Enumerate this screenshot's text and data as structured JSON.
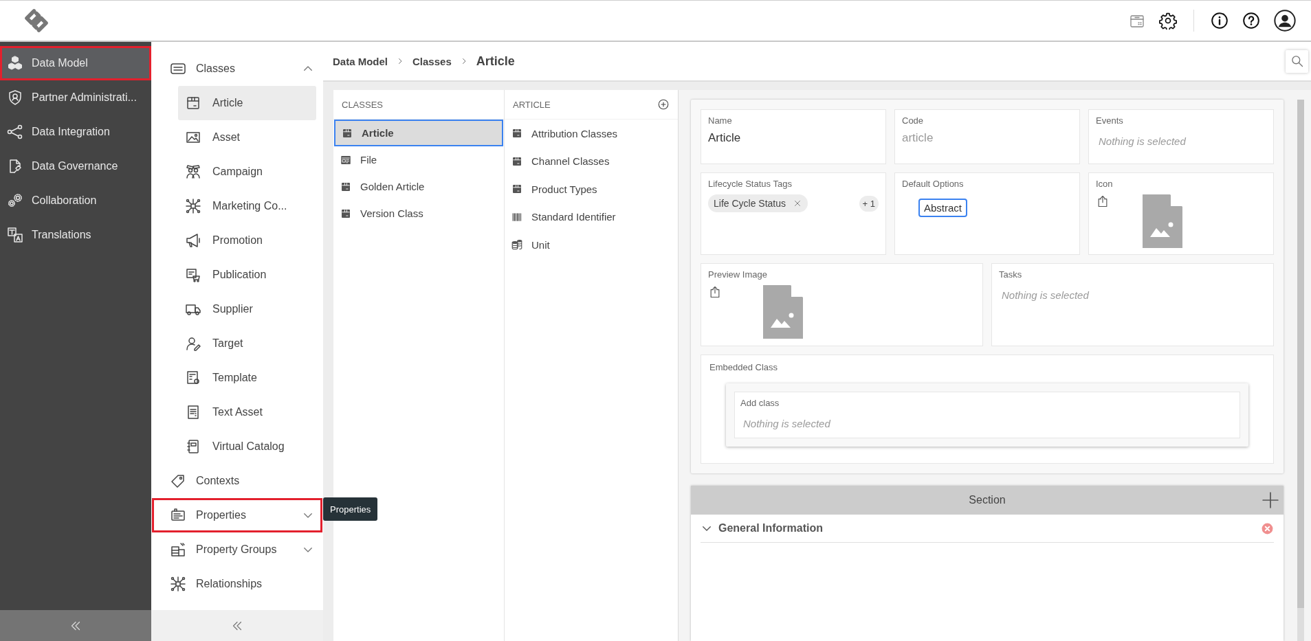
{
  "main_nav": {
    "items": [
      {
        "label": "Data Model",
        "selected": true,
        "highlighted": true
      },
      {
        "label": "Partner Administrati...",
        "selected": false,
        "highlighted": false
      },
      {
        "label": "Data Integration",
        "selected": false,
        "highlighted": false
      },
      {
        "label": "Data Governance",
        "selected": false,
        "highlighted": false
      },
      {
        "label": "Collaboration",
        "selected": false,
        "highlighted": false
      },
      {
        "label": "Translations",
        "selected": false,
        "highlighted": false
      }
    ]
  },
  "sub_nav": {
    "items": [
      {
        "kind": "group",
        "label": "Classes",
        "expanded": true,
        "highlighted": false,
        "children": [
          {
            "label": "Article",
            "selected": true
          },
          {
            "label": "Asset",
            "selected": false
          },
          {
            "label": "Campaign",
            "selected": false
          },
          {
            "label": "Marketing Co...",
            "selected": false
          },
          {
            "label": "Promotion",
            "selected": false
          },
          {
            "label": "Publication",
            "selected": false
          },
          {
            "label": "Supplier",
            "selected": false
          },
          {
            "label": "Target",
            "selected": false
          },
          {
            "label": "Template",
            "selected": false
          },
          {
            "label": "Text Asset",
            "selected": false
          },
          {
            "label": "Virtual Catalog",
            "selected": false
          }
        ]
      },
      {
        "kind": "link",
        "label": "Contexts",
        "highlighted": false
      },
      {
        "kind": "group",
        "label": "Properties",
        "expanded": false,
        "highlighted": true
      },
      {
        "kind": "group",
        "label": "Property Groups",
        "expanded": false,
        "highlighted": false
      },
      {
        "kind": "link",
        "label": "Relationships",
        "highlighted": false
      }
    ]
  },
  "tooltip": {
    "text": "Properties"
  },
  "breadcrumb": [
    "Data Model",
    "Classes",
    "Article"
  ],
  "classes_column": {
    "header": "CLASSES",
    "items": [
      {
        "label": "Article",
        "selected": true
      },
      {
        "label": "File",
        "selected": false
      },
      {
        "label": "Golden Article",
        "selected": false
      },
      {
        "label": "Version Class",
        "selected": false
      }
    ]
  },
  "article_column": {
    "header": "ARTICLE",
    "items": [
      "Attribution Classes",
      "Channel Classes",
      "Product Types",
      "Standard Identifier",
      "Unit"
    ]
  },
  "fields": [
    {
      "kind": "text",
      "label": "Name",
      "value": "Article"
    },
    {
      "kind": "readonly",
      "label": "Code",
      "value": "article"
    },
    {
      "kind": "select",
      "label": "Events",
      "placeholder": "Nothing is selected"
    },
    {
      "kind": "tags",
      "label": "Lifecycle Status Tags",
      "tags": [
        "Life Cycle Status"
      ],
      "more": "+ 1"
    },
    {
      "kind": "options",
      "label": "Default Options",
      "options": [
        {
          "label": "Abstract",
          "selected": true
        }
      ]
    },
    {
      "kind": "image",
      "label": "Icon"
    },
    {
      "kind": "image",
      "label": "Preview Image"
    },
    {
      "kind": "select",
      "label": "Tasks",
      "placeholder": "Nothing is selected"
    },
    {
      "kind": "embedded",
      "label": "Embedded Class",
      "inner": {
        "label": "Add class",
        "placeholder": "Nothing is selected"
      }
    }
  ],
  "section": {
    "title": "Section",
    "groups": [
      {
        "title": "General Information",
        "expanded": true
      }
    ]
  }
}
